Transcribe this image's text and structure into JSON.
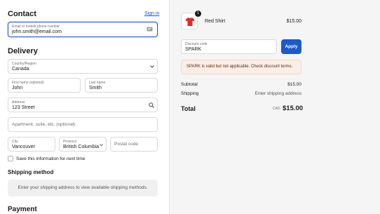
{
  "contact": {
    "heading": "Contact",
    "sign_in": "Sign in",
    "email_label": "Email or mobile phone number",
    "email_value": "john.smith@email.com"
  },
  "delivery": {
    "heading": "Delivery",
    "country_label": "Country/Region",
    "country_value": "Canada",
    "first_name_label": "First name (optional)",
    "first_name_value": "John",
    "last_name_label": "Last name",
    "last_name_value": "Smith",
    "address_label": "Address",
    "address_value": "123 Street",
    "apartment_placeholder": "Apartment, suite, etc. (optional)",
    "city_label": "City",
    "city_value": "Vancouver",
    "province_label": "Province",
    "province_value": "British Columbia",
    "postal_placeholder": "Postal code",
    "save_info_label": "Save this information for next time"
  },
  "shipping_method": {
    "heading": "Shipping method",
    "message": "Enter your shipping address to view available shipping methods."
  },
  "payment": {
    "heading": "Payment"
  },
  "summary": {
    "item_qty": "1",
    "item_name": "Red Shirt",
    "item_price": "$15.00",
    "discount_label": "Discount code",
    "discount_value": "SPARK",
    "apply_label": "Apply",
    "alert_text": "SPARK is valid but not applicable. Check discount terms.",
    "subtotal_label": "Subtotal",
    "subtotal_value": "$15.00",
    "shipping_label": "Shipping",
    "shipping_value": "Enter shipping address",
    "total_label": "Total",
    "total_currency": "CAD",
    "total_value": "$15.00"
  },
  "colors": {
    "accent": "#1f58c7",
    "alert_bg": "#fbeee6",
    "sidebar_bg": "#f5f5f5"
  }
}
